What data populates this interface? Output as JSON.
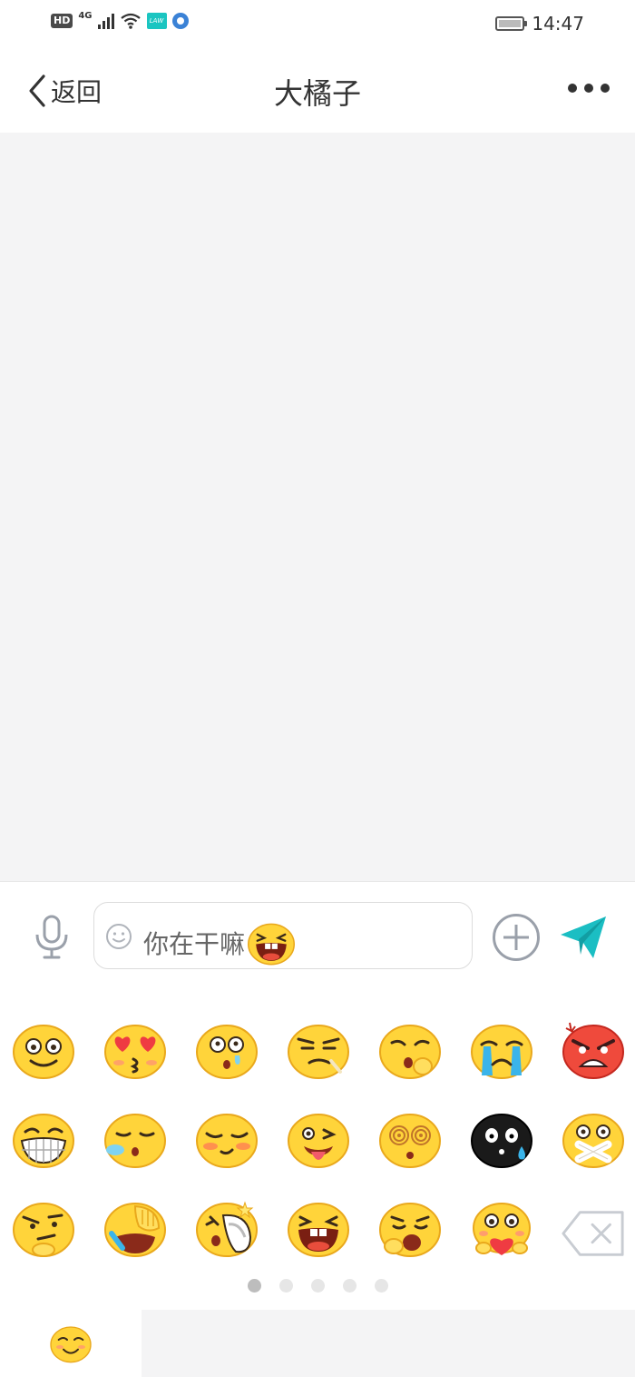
{
  "status_bar": {
    "hd_badge": "HD",
    "network": "4G",
    "app_badge": "LAW",
    "time": "14:47"
  },
  "header": {
    "back_label": "返回",
    "title": "大橘子",
    "more_icon": "more-dots-icon"
  },
  "input": {
    "text": "你在干嘛",
    "inline_emoji": "laughing-buck-teeth",
    "icons": [
      "microphone-icon",
      "smiley-icon",
      "plus-circle-icon",
      "send-paper-plane-icon"
    ]
  },
  "emoji_panel": {
    "rows": [
      [
        "smile",
        "heart-eyes-kiss",
        "stunned-drool",
        "smirk-sneer",
        "yawn-hand",
        "loud-cry",
        "angry-red"
      ],
      [
        "big-grin",
        "sleepy-drool",
        "shy-blush",
        "tongue-wink",
        "dizzy-spiral",
        "black-sweat",
        "zip-mouth"
      ],
      [
        "thinking-smirk",
        "facepalm-laugh",
        "slap-slipper",
        "laughing-buck-teeth",
        "yawn-tired",
        "heart-hold"
      ]
    ],
    "delete_icon": "backspace-delete-icon",
    "page_count": 5,
    "active_page": 1
  },
  "tab_strip": {
    "active_tab_icon": "smiley-emoji-icon"
  },
  "colors": {
    "accent": "#1bbec3",
    "chat_background": "#f4f4f5",
    "emoji_yellow": "#ffd43a",
    "icon_gray": "#9aa0aa"
  }
}
